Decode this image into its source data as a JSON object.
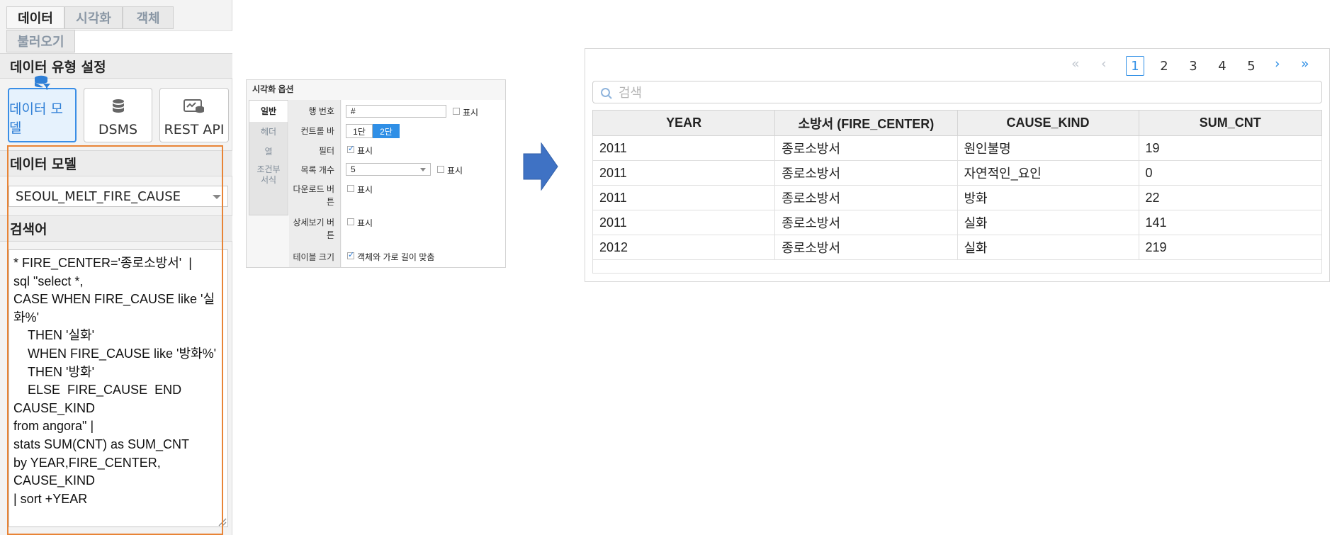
{
  "left_panel": {
    "tabs": [
      "데이터",
      "시각화",
      "객체",
      "불러오기"
    ],
    "data_type_heading": "데이터 유형 설정",
    "data_types": [
      {
        "label": "데이터 모델",
        "icon": "data-model-icon",
        "selected": true
      },
      {
        "label": "DSMS",
        "icon": "database-icon",
        "selected": false
      },
      {
        "label": "REST API",
        "icon": "rest-api-icon",
        "selected": false
      }
    ],
    "data_model_heading": "데이터 모델",
    "data_model_value": "SEOUL_MELT_FIRE_CAUSE",
    "search_heading": "검색어",
    "query": "* FIRE_CENTER='종로소방서'  |\nsql \"select *,\nCASE WHEN FIRE_CAUSE like '실\n화%'\n    THEN '실화'\n    WHEN FIRE_CAUSE like '방화%'\n    THEN '방화'\n    ELSE  FIRE_CAUSE  END\nCAUSE_KIND\nfrom angora\" |\nstats SUM(CNT) as SUM_CNT\nby YEAR,FIRE_CENTER,\nCAUSE_KIND\n| sort +YEAR",
    "highlight_color": "#e88436",
    "accent_color": "#2f7fd6"
  },
  "options_panel": {
    "title": "시각화 옵션",
    "tabs": [
      "일반",
      "헤더",
      "열",
      "조건부\n서식"
    ],
    "labels": {
      "row_number": "행 번호",
      "control_bar": "컨트롤 바",
      "filter": "필터",
      "list_count": "목록 개수",
      "download_button": "다운로드 버\n튼",
      "detail_button": "상세보기 버\n튼",
      "table_size": "테이블 크기"
    },
    "row_number_value": "#",
    "show_label": "표시",
    "control_bar_options": [
      "1단",
      "2단"
    ],
    "list_count_value": "5",
    "table_size_text": "객체와 가로 길이 맞춤"
  },
  "result_panel": {
    "pagination": {
      "first_icon": "double-chevron-left-icon",
      "prev_icon": "chevron-left-icon",
      "pages": [
        "1",
        "2",
        "3",
        "4",
        "5"
      ],
      "current_page": "1",
      "next_icon": "chevron-right-icon",
      "last_icon": "double-chevron-right-icon"
    },
    "search_placeholder": "검색",
    "columns": [
      "YEAR",
      "소방서 (FIRE_CENTER)",
      "CAUSE_KIND",
      "SUM_CNT"
    ],
    "rows": [
      [
        "2011",
        "종로소방서",
        "원인불명",
        "19"
      ],
      [
        "2011",
        "종로소방서",
        "자연적인_요인",
        "0"
      ],
      [
        "2011",
        "종로소방서",
        "방화",
        "22"
      ],
      [
        "2011",
        "종로소방서",
        "실화",
        "141"
      ],
      [
        "2012",
        "종로소방서",
        "실화",
        "219"
      ]
    ]
  },
  "arrow_color": "#3f72c4"
}
